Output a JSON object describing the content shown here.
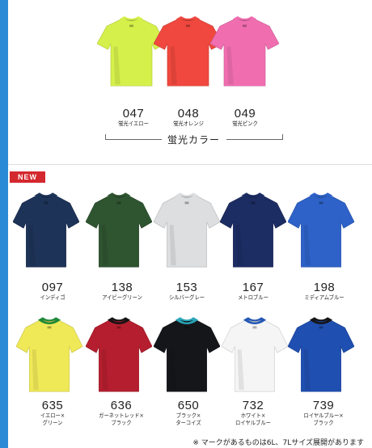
{
  "fluorescent": {
    "label": "蛍光カラー",
    "items": [
      {
        "code": "047",
        "name": "蛍光イエロー",
        "body": "#d6f04b",
        "collar": "#d6f04b",
        "accent": "#d6f04b"
      },
      {
        "code": "048",
        "name": "蛍光オレンジ",
        "body": "#f0483e",
        "collar": "#f0483e",
        "accent": "#f0483e"
      },
      {
        "code": "049",
        "name": "蛍光ピンク",
        "body": "#f06eb0",
        "collar": "#f06eb0",
        "accent": "#f06eb0"
      }
    ]
  },
  "new_badge": "NEW",
  "row1": [
    {
      "code": "097",
      "name": "インディゴ",
      "body": "#1d3358",
      "collar": "#1d3358",
      "accent": "#1d3358"
    },
    {
      "code": "138",
      "name": "アイビーグリーン",
      "body": "#2f5430",
      "collar": "#2f5430",
      "accent": "#2f5430"
    },
    {
      "code": "153",
      "name": "シルバーグレー",
      "body": "#dcdee0",
      "collar": "#dcdee0",
      "accent": "#dcdee0"
    },
    {
      "code": "167",
      "name": "メトロブルー",
      "body": "#1c2d63",
      "collar": "#1c2d63",
      "accent": "#1c2d63"
    },
    {
      "code": "198",
      "name": "ミディアムブルー",
      "body": "#2e62c8",
      "collar": "#2e62c8",
      "accent": "#2e62c8"
    }
  ],
  "row2": [
    {
      "code": "635",
      "name_line1": "イエロー×",
      "name_line2": "グリーン",
      "body": "#f0e957",
      "collar": "#1e8a3a",
      "accent": "#f0e957"
    },
    {
      "code": "636",
      "name_line1": "ガーネットレッド×",
      "name_line2": "ブラック",
      "body": "#b51e2e",
      "collar": "#151515",
      "accent": "#b51e2e"
    },
    {
      "code": "650",
      "name_line1": "ブラック×",
      "name_line2": "ターコイズ",
      "body": "#15161a",
      "collar": "#2aa5b8",
      "accent": "#15161a"
    },
    {
      "code": "732",
      "name_line1": "ホワイト×",
      "name_line2": "ロイヤルブルー",
      "body": "#f5f5f5",
      "collar": "#2458b5",
      "accent": "#f5f5f5"
    },
    {
      "code": "739",
      "name_line1": "ロイヤルブルー×",
      "name_line2": "ブラック",
      "body": "#1f4fb0",
      "collar": "#151515",
      "accent": "#1f4fb0"
    }
  ],
  "footnote": "※ マークがあるものは6L、7Lサイズ展開があります"
}
